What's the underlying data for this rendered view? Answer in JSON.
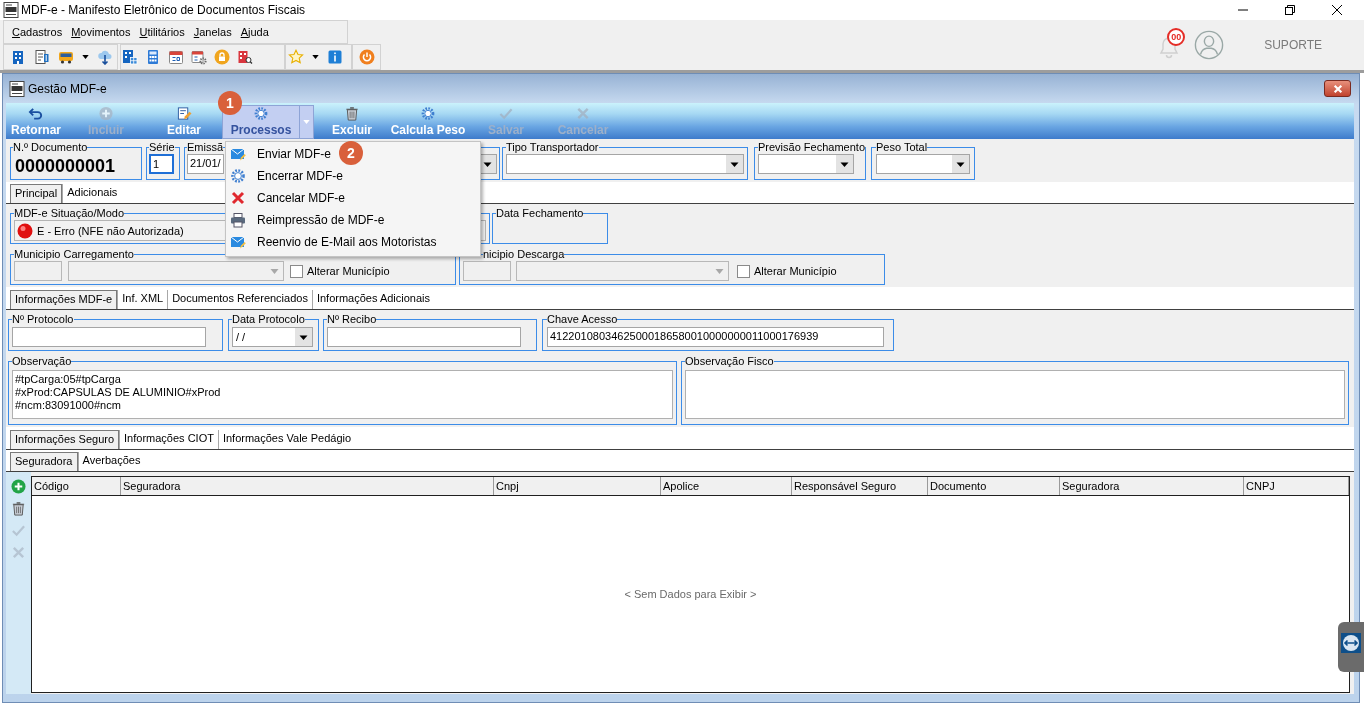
{
  "window": {
    "title": "MDF-e - Manifesto Eletrônico de Documentos Fiscais"
  },
  "menu_bar": [
    "Cadastros",
    "Movimentos",
    "Utilitários",
    "Janelas",
    "Ajuda"
  ],
  "header_right": {
    "notification_count": "00",
    "user": "SUPORTE"
  },
  "child_window": {
    "title": "Gestão MDF-e"
  },
  "actions": [
    {
      "label": "Retornar",
      "disabled": false,
      "pressed": false,
      "dropdown": false
    },
    {
      "label": "Incluir",
      "disabled": true,
      "pressed": false,
      "dropdown": false
    },
    {
      "label": "Editar",
      "disabled": false,
      "pressed": false,
      "dropdown": false
    },
    {
      "label": "Processos",
      "disabled": false,
      "pressed": true,
      "dropdown": true
    },
    {
      "label": "Excluir",
      "disabled": false,
      "pressed": false,
      "dropdown": false
    },
    {
      "label": "Calcula Peso",
      "disabled": false,
      "pressed": false,
      "dropdown": false
    },
    {
      "label": "Salvar",
      "disabled": true,
      "pressed": false,
      "dropdown": false
    },
    {
      "label": "Cancelar",
      "disabled": true,
      "pressed": false,
      "dropdown": false
    }
  ],
  "callouts": [
    "1",
    "2"
  ],
  "process_menu": [
    "Enviar MDF-e",
    "Encerrar MDF-e",
    "Cancelar MDF-e",
    "Reimpressão de MDF-e",
    "Reenvio de E-Mail aos Motoristas"
  ],
  "header_fields": [
    {
      "label": "N.º Documento",
      "kind": "display",
      "value": "0000000001",
      "focused": false
    },
    {
      "label": "Série",
      "kind": "input",
      "value": "1",
      "focused": true
    },
    {
      "label": "Emissã",
      "kind": "date",
      "value": "21/01/",
      "focused": false
    },
    {
      "label": "Tipo Transportador",
      "kind": "select",
      "focused": false
    },
    {
      "label": "Previsão Fechamento",
      "kind": "select",
      "focused": false
    },
    {
      "label": "Peso Total",
      "kind": "select",
      "focused": false
    }
  ],
  "main_tabs": [
    {
      "label": "Principal",
      "selected": true
    },
    {
      "label": "Adicionais",
      "selected": false
    }
  ],
  "situacao": {
    "label": "MDF-e Situação/Modo",
    "value": "E - Erro (NFE não Autorizada)"
  },
  "data_fechamento": {
    "label": "Data Fechamento"
  },
  "municipios": [
    {
      "label": "Municipio Carregamento",
      "checkbox": "Alterar Município",
      "checked": false
    },
    {
      "label": "nicipio Descarga",
      "checkbox": "Alterar Município",
      "checked": false
    }
  ],
  "info_tabs": [
    {
      "label": "Informações MDF-e",
      "selected": true
    },
    {
      "label": "Inf. XML",
      "selected": false
    },
    {
      "label": "Documentos Referenciados",
      "selected": false
    },
    {
      "label": "Informações Adicionais",
      "selected": false
    }
  ],
  "info_fields": [
    {
      "label": "Nº Protocolo",
      "kind": "input"
    },
    {
      "label": "Data Protocolo",
      "kind": "select",
      "value": "/ /"
    },
    {
      "label": "Nº Recibo",
      "kind": "input"
    },
    {
      "label": "Chave Acesso",
      "kind": "input",
      "value": "41220108034625000186580010000000011000176939"
    }
  ],
  "observacao": {
    "label": "Observação",
    "lines": [
      "#tpCarga:05#tpCarga",
      "#xProd:CAPSULAS DE ALUMINIO#xProd",
      "#ncm:83091000#ncm"
    ]
  },
  "observacao_fisco": {
    "label": "Observação Fisco"
  },
  "seguro_tabs": [
    {
      "label": "Informações Seguro",
      "selected": true
    },
    {
      "label": "Informações CIOT",
      "selected": false
    },
    {
      "label": "Informações Vale Pedágio",
      "selected": false
    }
  ],
  "seguro_subtabs": [
    {
      "label": "Seguradora",
      "selected": true
    },
    {
      "label": "Averbações",
      "selected": false
    }
  ],
  "grid_tools": [
    {
      "disabled": false
    },
    {
      "disabled": false
    },
    {
      "disabled": true
    },
    {
      "disabled": true
    }
  ],
  "table": {
    "columns": [
      "Código",
      "Seguradora",
      "Cnpj",
      "Apolice",
      "Responsável Seguro",
      "Documento",
      "Seguradora",
      "CNPJ"
    ],
    "empty_message": "< Sem Dados para Exibir >"
  }
}
